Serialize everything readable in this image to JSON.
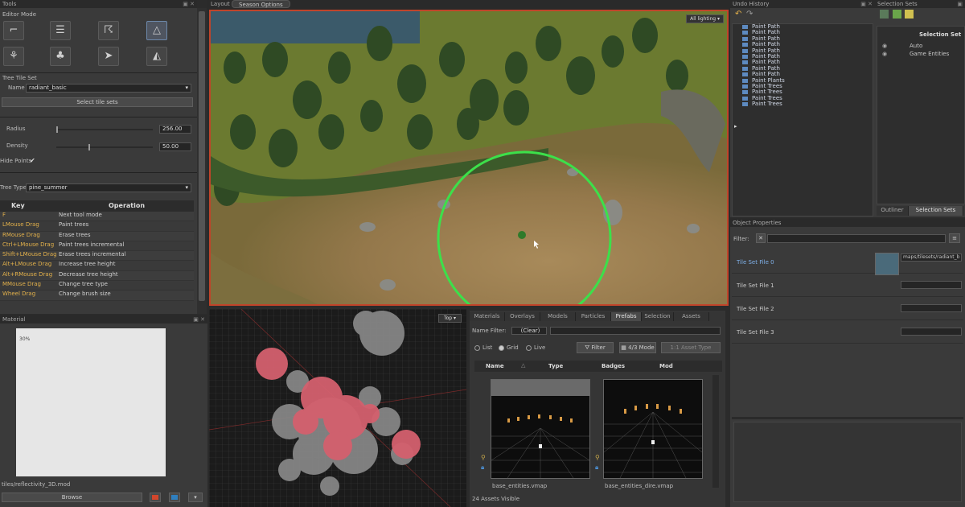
{
  "left": {
    "tools_title": "Tools",
    "mode_label": "Editor Mode",
    "tileset_label": "Tree Tile Set",
    "name_label": "Name",
    "name_value": "radiant_basic",
    "select_tilesets": "Select tile sets",
    "radius_label": "Radius",
    "radius_value": "256.00",
    "density_label": "Density",
    "density_value": "50.00",
    "hide_label": "Hide Points",
    "tree_type_label": "Tree Type",
    "tree_type_value": "pine_summer",
    "table_headers": [
      "Key",
      "Operation"
    ],
    "keys": [
      {
        "key": "F",
        "op": "Next tool mode"
      },
      {
        "key": "LMouse Drag",
        "op": "Paint trees"
      },
      {
        "key": "RMouse Drag",
        "op": "Erase trees"
      },
      {
        "key": "Ctrl+LMouse Drag",
        "op": "Paint trees incremental"
      },
      {
        "key": "Shift+LMouse Drag",
        "op": "Erase trees incremental"
      },
      {
        "key": "Alt+LMouse Drag",
        "op": "Increase tree height"
      },
      {
        "key": "Alt+RMouse Drag",
        "op": "Decrease tree height"
      },
      {
        "key": "MMouse Drag",
        "op": "Change tree type"
      },
      {
        "key": "Wheel Drag",
        "op": "Change brush size"
      }
    ],
    "material_title": "Material",
    "preview_caption": "30%",
    "material_path": "tiles/reflectivity_3D.mod",
    "browse_label": "Browse"
  },
  "center": {
    "layout_label": "Layout",
    "season_label": "Season Options",
    "lighting_label": "All lighting",
    "top_label": "Top"
  },
  "assets": {
    "tabs": [
      "Materials",
      "Overlays",
      "Models",
      "Particles",
      "Prefabs",
      "Selection",
      "Assets"
    ],
    "active_tab": "Prefabs",
    "name_filter_label": "Name Filter:",
    "name_filter_value": "(Clear)",
    "view_list": "List",
    "view_grid": "Grid",
    "view_live": "Live",
    "filter_label": "Filter",
    "mode_label": "4/3 Mode",
    "aspect_label": "1:1 Asset Type",
    "columns": [
      "Name",
      "Type",
      "Badges",
      "Mod"
    ],
    "items": [
      "base_entities.vmap",
      "base_entities_dire.vmap"
    ],
    "count_label": "24 Assets Visible"
  },
  "history": {
    "title": "Undo History",
    "items": [
      "Paint Path",
      "Paint Path",
      "Paint Path",
      "Paint Path",
      "Paint Path",
      "Paint Path",
      "Paint Path",
      "Paint Path",
      "Paint Path",
      "Paint Plants",
      "Paint Trees",
      "Paint Trees",
      "Paint Trees",
      "Paint Trees"
    ]
  },
  "selection": {
    "title": "Selection Sets",
    "header": "Selection Set",
    "item1": "Auto",
    "item2": "Game Entities",
    "tab_outliner": "Outliner",
    "tab_sets": "Selection Sets"
  },
  "props": {
    "title": "Object Properties",
    "filter_label": "Filter:",
    "rows": [
      "Tile Set File 0",
      "Tile Set File 1",
      "Tile Set File 2",
      "Tile Set File 3"
    ],
    "file_value": "maps/tilesets/radiant_b"
  }
}
